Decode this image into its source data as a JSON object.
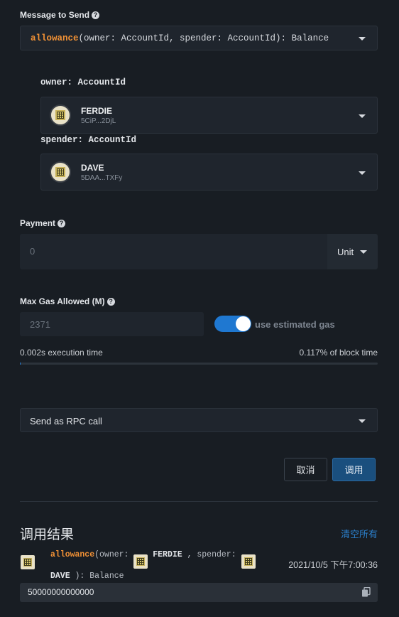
{
  "message": {
    "label": "Message to Send",
    "fn_name": "allowance",
    "fn_sig": "(owner: AccountId, spender: AccountId): Balance"
  },
  "params": [
    {
      "label": "owner: AccountId",
      "name": "FERDIE",
      "address": "5CiP...2DjL"
    },
    {
      "label": "spender: AccountId",
      "name": "DAVE",
      "address": "5DAA...TXFy"
    }
  ],
  "payment": {
    "label": "Payment",
    "value": "0",
    "unit": "Unit"
  },
  "gas": {
    "label": "Max Gas Allowed (M)",
    "value": "2371",
    "toggle_label": "use estimated gas",
    "toggle_on": true,
    "exec_time": "0.002s execution time",
    "block_time": "0.117% of block time",
    "progress_fraction": 0.00117
  },
  "send_mode": {
    "value": "Send as RPC call"
  },
  "buttons": {
    "cancel": "取消",
    "call": "调用"
  },
  "results": {
    "title": "调用结果",
    "clear": "清空所有",
    "fn_name": "allowance",
    "owner_prefix": "(owner:",
    "owner_name": "FERDIE",
    "spender_prefix": ", spender:",
    "spender_name": "DAVE",
    "suffix": "): Balance",
    "timestamp": "2021/10/5 下午7:00:36",
    "output": "50000000000000"
  },
  "colors": {
    "accent": "#1f78d1",
    "call_button": "#1a4f7e",
    "function": "#f19135",
    "link": "#2b80cc"
  },
  "icons": [
    "help-icon",
    "chevron-down-icon",
    "identicon",
    "copy-icon"
  ]
}
